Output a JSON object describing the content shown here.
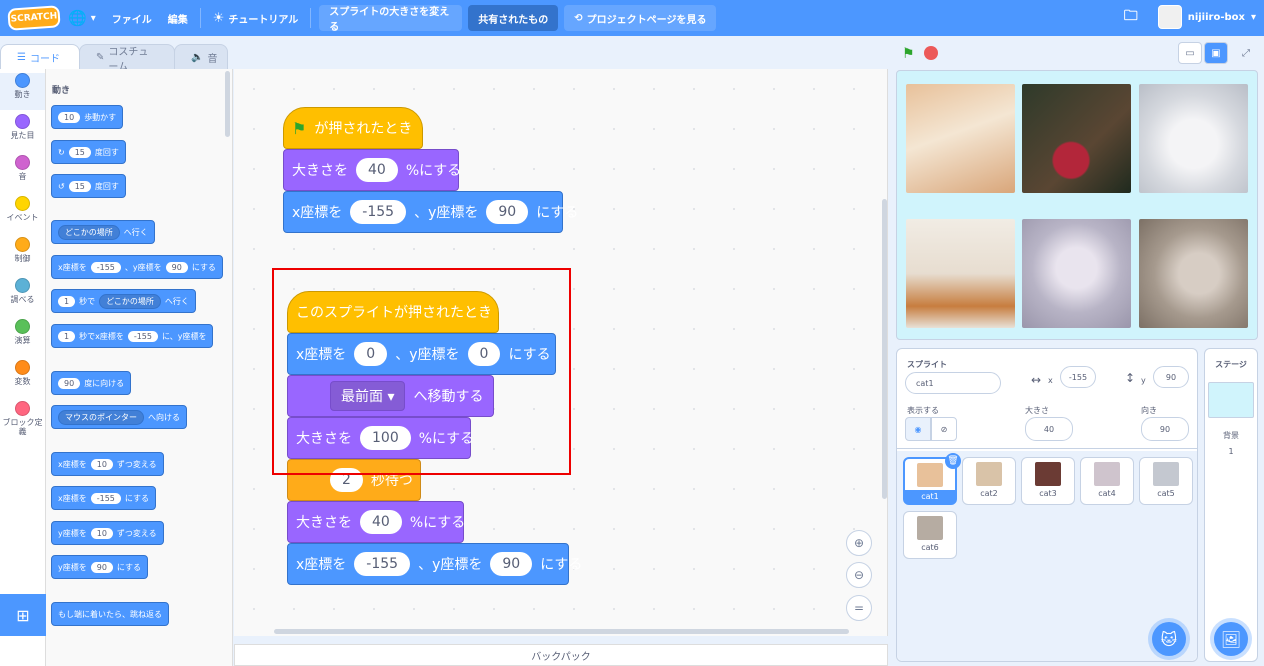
{
  "menu": {
    "logo": "SCRATCH",
    "file": "ファイル",
    "edit": "編集",
    "tutorial": "チュートリアル",
    "project_title": "スプライトの大きさを変える",
    "shared": "共有されたもの",
    "project_page": "プロジェクトページを見る",
    "username": "nijiiro-box"
  },
  "tabs": {
    "code": "コード",
    "costume": "コスチューム",
    "sound": "音"
  },
  "categories": [
    {
      "label": "動き",
      "color": "#4c97ff"
    },
    {
      "label": "見た目",
      "color": "#9966ff"
    },
    {
      "label": "音",
      "color": "#cf63cf"
    },
    {
      "label": "イベント",
      "color": "#ffd500"
    },
    {
      "label": "制御",
      "color": "#ffab19"
    },
    {
      "label": "調べる",
      "color": "#5cb1d6"
    },
    {
      "label": "演算",
      "color": "#59c059"
    },
    {
      "label": "変数",
      "color": "#ff8c1a"
    },
    {
      "label": "ブロック定義",
      "color": "#ff6680"
    }
  ],
  "palette": {
    "heading": "動き",
    "b1": {
      "v": "10",
      "t": "歩動かす"
    },
    "b2": {
      "v": "15",
      "t": "度回す"
    },
    "b3": {
      "v": "15",
      "t": "度回す"
    },
    "b4": {
      "dd": "どこかの場所",
      "t": "へ行く"
    },
    "b5": {
      "a": "x座標を",
      "x": "-155",
      "b": "、y座標を",
      "y": "90",
      "c": "にする"
    },
    "b6": {
      "v": "1",
      "a": "秒で",
      "dd": "どこかの場所",
      "t": "へ行く"
    },
    "b7": {
      "v": "1",
      "a": "秒でx座標を",
      "x": "-155",
      "b": "に、y座標を"
    },
    "b8": {
      "v": "90",
      "t": "度に向ける"
    },
    "b9": {
      "dd": "マウスのポインター",
      "t": "へ向ける"
    },
    "b10": {
      "a": "x座標を",
      "v": "10",
      "t": "ずつ変える"
    },
    "b11": {
      "a": "x座標を",
      "v": "-155",
      "t": "にする"
    },
    "b12": {
      "a": "y座標を",
      "v": "10",
      "t": "ずつ変える"
    },
    "b13": {
      "a": "y座標を",
      "v": "90",
      "t": "にする"
    },
    "b14": {
      "t": "もし端に着いたら、跳ね返る"
    }
  },
  "script1": {
    "hat": "が押されたとき",
    "s1a": "大きさを",
    "s1v": "40",
    "s1b": "%にする",
    "s2a": "x座標を",
    "s2x": "-155",
    "s2b": "、y座標を",
    "s2y": "90",
    "s2c": "にする"
  },
  "script2": {
    "hat": "このスプライトが押されたとき",
    "s1a": "x座標を",
    "s1x": "0",
    "s1b": "、y座標を",
    "s1y": "0",
    "s1c": "にする",
    "s2dd": "最前面",
    "s2t": "へ移動する",
    "s3a": "大きさを",
    "s3v": "100",
    "s3b": "%にする",
    "s4v": "2",
    "s4t": "秒待つ",
    "s5a": "大きさを",
    "s5v": "40",
    "s5b": "%にする",
    "s6a": "x座標を",
    "s6x": "-155",
    "s6b": "、y座標を",
    "s6y": "90",
    "s6c": "にする"
  },
  "backpack": "バックパック",
  "sprite_info": {
    "label": "スプライト",
    "name": "cat1",
    "x_label": "x",
    "x": "-155",
    "y_label": "y",
    "y": "90",
    "show_label": "表示する",
    "size_label": "大きさ",
    "size": "40",
    "dir_label": "向き",
    "dir": "90"
  },
  "sprites": [
    "cat1",
    "cat2",
    "cat3",
    "cat4",
    "cat5",
    "cat6"
  ],
  "stage_panel": {
    "label": "ステージ",
    "bg_label": "背景",
    "bg_count": "1"
  }
}
